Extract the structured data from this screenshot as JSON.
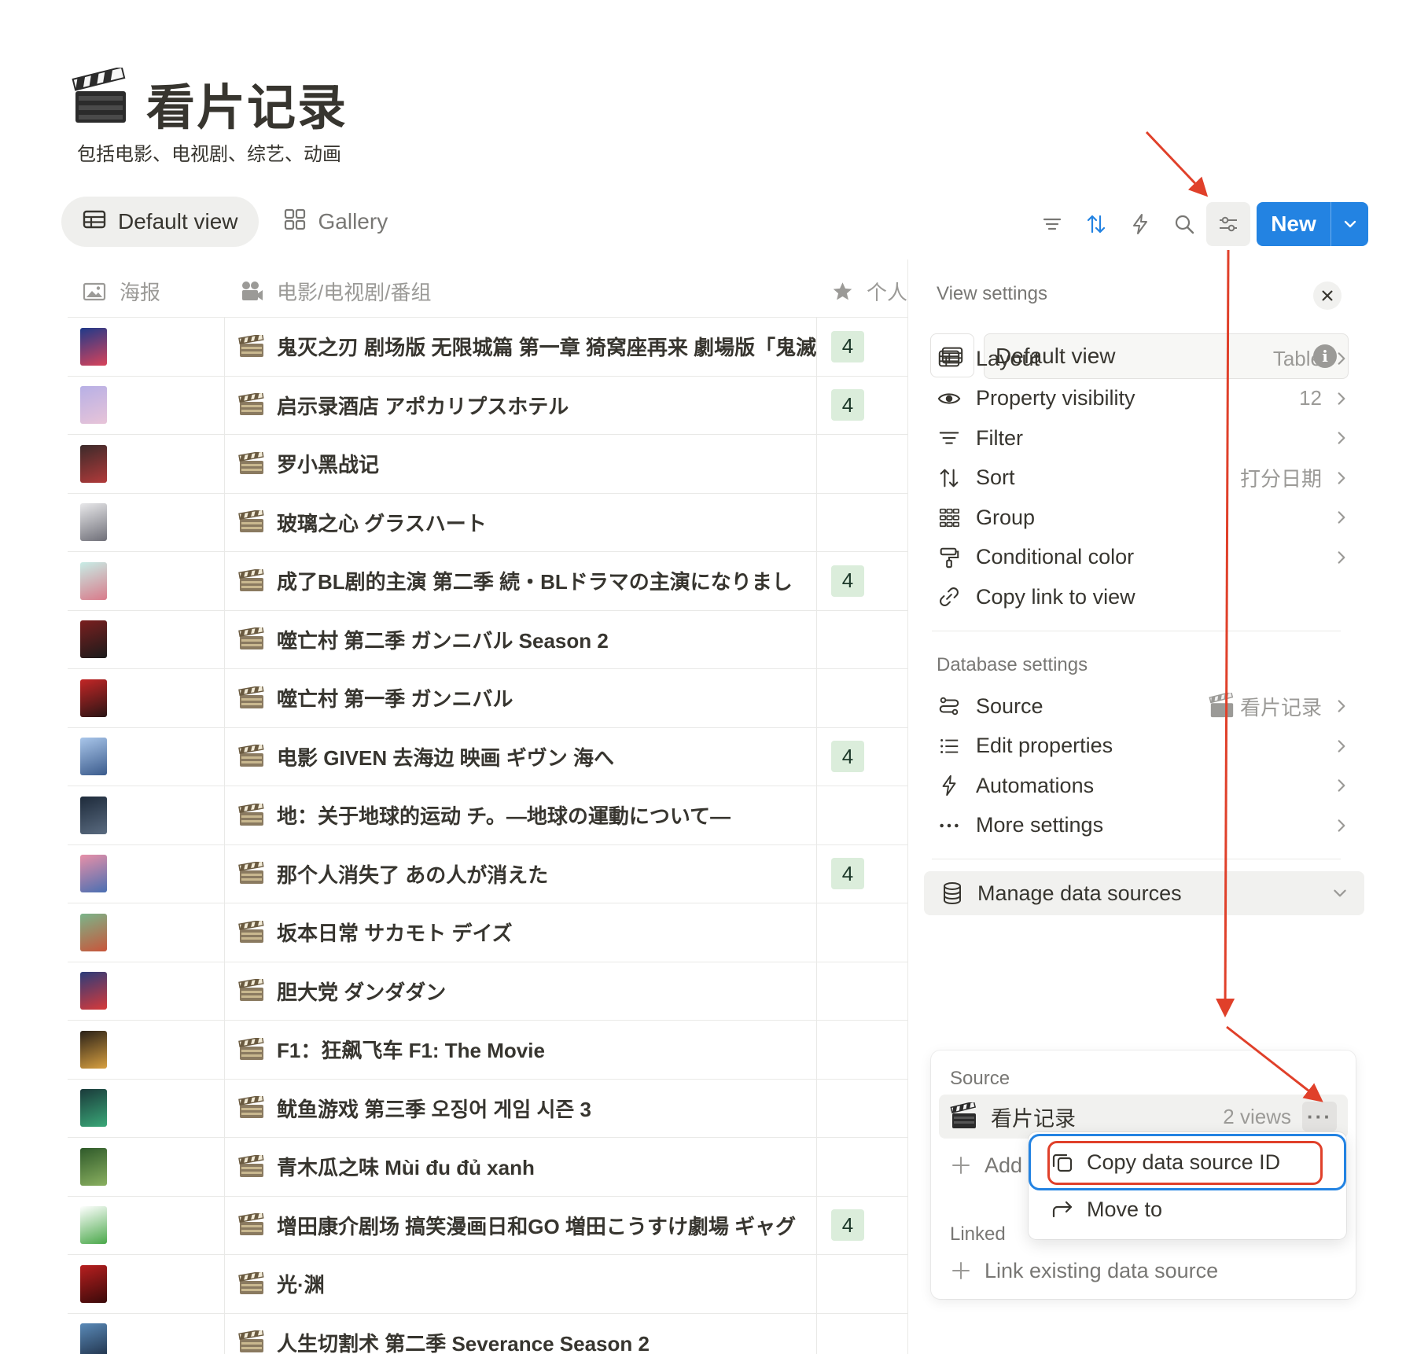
{
  "page": {
    "title": "看片记录",
    "description": "包括电影、电视剧、综艺、动画",
    "icon": "clapperboard-icon"
  },
  "views": [
    {
      "label": "Default view",
      "icon": "table-icon",
      "active": true
    },
    {
      "label": "Gallery",
      "icon": "gallery-icon",
      "active": false
    }
  ],
  "toolbar": {
    "icons": [
      "filter-icon",
      "sort-icon",
      "automation-icon",
      "search-icon",
      "settings-icon"
    ],
    "new_label": "New",
    "accent": "#2383e2"
  },
  "table": {
    "columns": [
      {
        "label": "海报",
        "icon": "image-icon"
      },
      {
        "label": "电影/电视剧/番组",
        "icon": "movie-camera-icon"
      },
      {
        "label": "个人",
        "icon": "star-icon"
      }
    ],
    "rows": [
      {
        "title": "鬼灭之刃 剧场版 无限城篇 第一章 猗窝座再来 劇場版「鬼滅",
        "rating": "4",
        "poster": [
          "#1f3a8a",
          "#d9435a"
        ]
      },
      {
        "title": "启示录酒店 アポカリプスホテル",
        "rating": "4",
        "poster": [
          "#b7b0e6",
          "#e8c4d8"
        ]
      },
      {
        "title": "罗小黑战记",
        "rating": "",
        "poster": [
          "#3b2a2a",
          "#b23a3a"
        ]
      },
      {
        "title": "玻璃之心 グラスハート",
        "rating": "",
        "poster": [
          "#e8e8ea",
          "#6f6f78"
        ]
      },
      {
        "title": "成了BL剧的主演 第二季 続・BLドラマの主演になりまし",
        "rating": "4",
        "poster": [
          "#c7ede6",
          "#d97a8a"
        ]
      },
      {
        "title": "噬亡村 第二季 ガンニバル Season 2",
        "rating": "",
        "poster": [
          "#7a1f1f",
          "#1b1b1b"
        ]
      },
      {
        "title": "噬亡村 第一季 ガンニバル",
        "rating": "",
        "poster": [
          "#c32626",
          "#2a1515"
        ]
      },
      {
        "title": "电影 GIVEN 去海边 映画 ギヴン 海へ",
        "rating": "4",
        "poster": [
          "#a9c6ea",
          "#3b5b8c"
        ]
      },
      {
        "title": "地：关于地球的运动 チ。―地球の運動について―",
        "rating": "",
        "poster": [
          "#1d2a3a",
          "#5a6b80"
        ]
      },
      {
        "title": "那个人消失了 あの人が消えた",
        "rating": "4",
        "poster": [
          "#e890a8",
          "#4a6fb2"
        ]
      },
      {
        "title": "坂本日常 サカモト デイズ",
        "rating": "",
        "poster": [
          "#7ab58a",
          "#c9553a"
        ]
      },
      {
        "title": "胆大党 ダンダダン",
        "rating": "",
        "poster": [
          "#2b3c7a",
          "#d83a3a"
        ]
      },
      {
        "title": "F1：狂飙飞车 F1: The Movie",
        "rating": "",
        "poster": [
          "#2a2118",
          "#d8a040"
        ]
      },
      {
        "title": "鱿鱼游戏 第三季 오징어 게임 시즌 3",
        "rating": "",
        "poster": [
          "#1a3a3a",
          "#3aa878"
        ]
      },
      {
        "title": "青木瓜之味 Mùi đu đủ xanh",
        "rating": "",
        "poster": [
          "#2f5a2a",
          "#8ab060"
        ]
      },
      {
        "title": "增田康介剧场 搞笑漫画日和GO 増田こうすけ劇場 ギャグ",
        "rating": "4",
        "poster": [
          "#ffffff",
          "#4aa84a"
        ]
      },
      {
        "title": "光·渊",
        "rating": "",
        "poster": [
          "#b81f1f",
          "#3a0a0a"
        ]
      },
      {
        "title": "人生切割术 第二季 Severance Season 2",
        "rating": "",
        "poster": [
          "#5a8ab8",
          "#1b2a40"
        ]
      }
    ]
  },
  "panel": {
    "header": "View settings",
    "view_name": "Default view",
    "view_items": [
      {
        "label": "Layout",
        "value": "Table",
        "icon": "table-icon"
      },
      {
        "label": "Property visibility",
        "value": "12",
        "icon": "eye-icon"
      },
      {
        "label": "Filter",
        "value": "",
        "icon": "filter-icon"
      },
      {
        "label": "Sort",
        "value": "打分日期",
        "icon": "sort-icon"
      },
      {
        "label": "Group",
        "value": "",
        "icon": "group-icon"
      },
      {
        "label": "Conditional color",
        "value": "",
        "icon": "paint-roller-icon"
      },
      {
        "label": "Copy link to view",
        "value": "",
        "icon": "link-icon"
      }
    ],
    "database_label": "Database settings",
    "db_items": [
      {
        "label": "Source",
        "value": "看片记录",
        "icon": "source-icon"
      },
      {
        "label": "Edit properties",
        "value": "",
        "icon": "list-icon"
      },
      {
        "label": "Automations",
        "value": "",
        "icon": "automation-icon"
      },
      {
        "label": "More settings",
        "value": "",
        "icon": "more-icon"
      }
    ],
    "manage_label": "Manage data sources"
  },
  "data_sources": {
    "source_label": "Source",
    "source_name": "看片记录",
    "source_views": "2 views",
    "add_label": "Add",
    "linked_label": "Linked",
    "link_existing": "Link existing data source"
  },
  "context_menu": {
    "items": [
      {
        "label": "Copy data source ID",
        "icon": "copy-icon"
      },
      {
        "label": "Move to",
        "icon": "move-to-icon"
      }
    ]
  },
  "colors": {
    "accent": "#2383e2",
    "annotation_red": "#e0402a",
    "rating_bg": "#dbeddb",
    "text": "#37352f",
    "muted": "#9b9a97"
  }
}
